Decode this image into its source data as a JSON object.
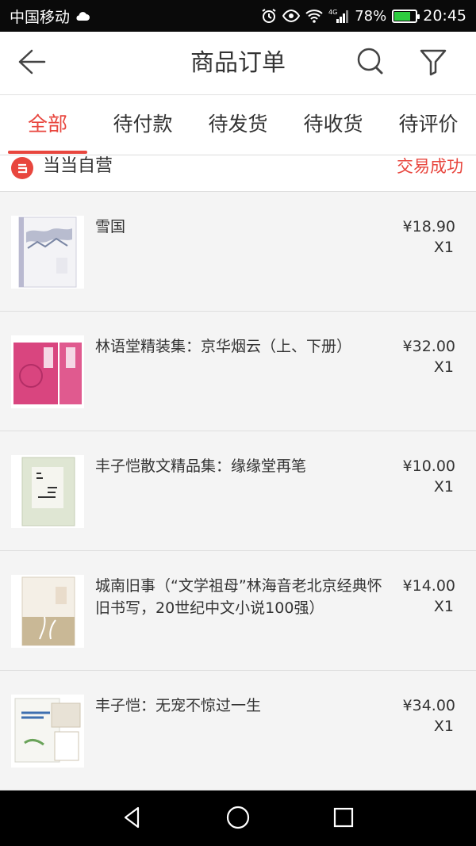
{
  "status_bar": {
    "carrier": "中国移动",
    "network": "4G",
    "battery_percent": "78%",
    "battery_level": 0.78,
    "time": "20:45",
    "icons": [
      "cloud-icon",
      "alarm-icon",
      "eye-icon",
      "wifi-icon",
      "signal-icon",
      "battery-icon"
    ]
  },
  "header": {
    "title": "商品订单",
    "icons": [
      "back-arrow-icon",
      "search-icon",
      "filter-icon"
    ]
  },
  "tabs": [
    {
      "label": "全部",
      "active": true
    },
    {
      "label": "待付款",
      "active": false
    },
    {
      "label": "待发货",
      "active": false
    },
    {
      "label": "待收货",
      "active": false
    },
    {
      "label": "待评价",
      "active": false
    }
  ],
  "order": {
    "shop_name": "当当自营",
    "status": "交易成功",
    "items": [
      {
        "name": "雪国",
        "price": "¥18.90",
        "qty": "X1"
      },
      {
        "name": "林语堂精装集：京华烟云（上、下册）",
        "price": "¥32.00",
        "qty": "X1"
      },
      {
        "name": "丰子恺散文精品集：缘缘堂再笔",
        "price": "¥10.00",
        "qty": "X1"
      },
      {
        "name": "城南旧事（“文学祖母”林海音老北京经典怀旧书写，20世纪中文小说100强）",
        "price": "¥14.00",
        "qty": "X1"
      },
      {
        "name": "丰子恺：无宠不惊过一生",
        "price": "¥34.00",
        "qty": "X1"
      }
    ]
  },
  "colors": {
    "accent": "#e8463e",
    "text": "#333333",
    "background": "#f4f4f4"
  },
  "nav_bar": {
    "icons": [
      "back-triangle-icon",
      "home-circle-icon",
      "recents-square-icon"
    ]
  }
}
